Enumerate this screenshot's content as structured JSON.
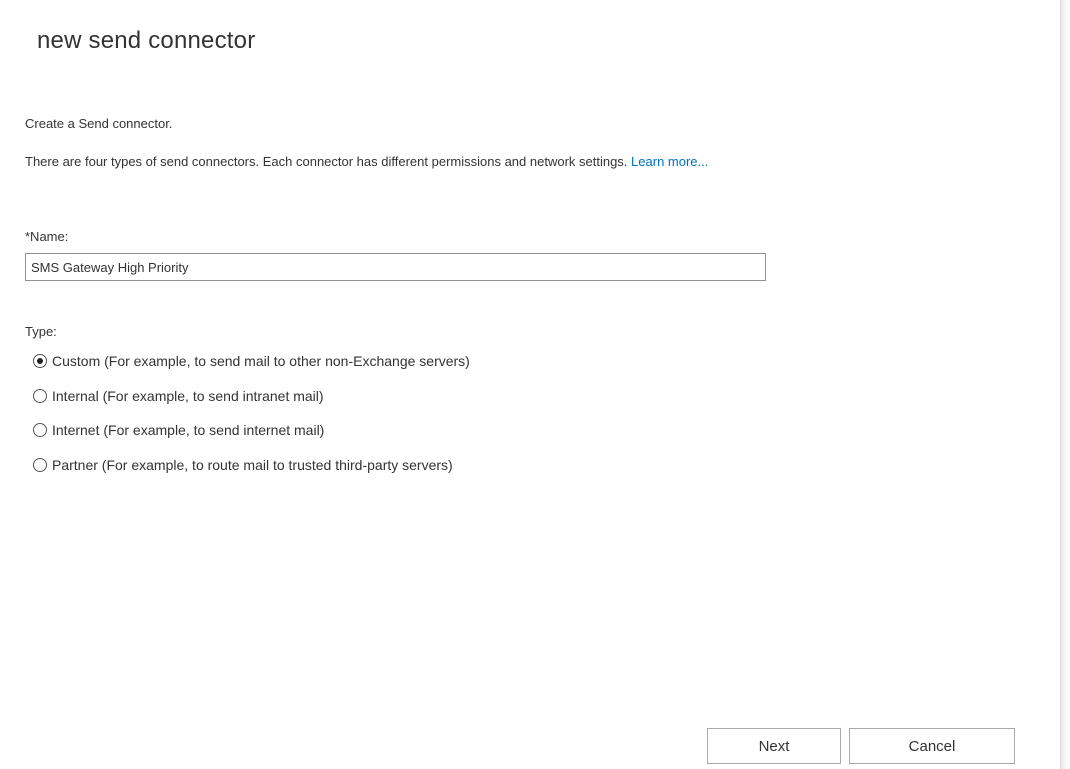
{
  "dialog": {
    "title": "new send connector",
    "intro": "Create a Send connector.",
    "description": "There are four types of send connectors. Each connector has different permissions and network settings.",
    "learn_more": "Learn more..."
  },
  "name_field": {
    "label": "*Name:",
    "value": "SMS Gateway High Priority"
  },
  "type_group": {
    "label": "Type:",
    "selected": "Custom",
    "options": [
      {
        "label": "Custom (For example, to send mail to other non-Exchange servers)",
        "checked": true
      },
      {
        "label": "Internal (For example, to send intranet mail)",
        "checked": false
      },
      {
        "label": "Internet (For example, to send internet mail)",
        "checked": false
      },
      {
        "label": "Partner (For example, to route mail to trusted third-party servers)",
        "checked": false
      }
    ]
  },
  "buttons": {
    "next": "Next",
    "cancel": "Cancel"
  },
  "colors": {
    "link": "#0072c6",
    "text": "#333333",
    "border": "#919191"
  }
}
